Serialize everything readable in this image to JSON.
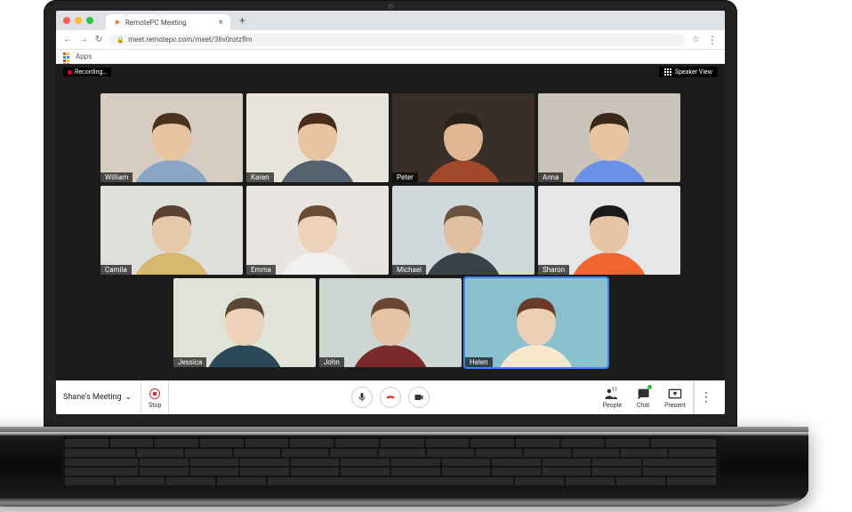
{
  "browser": {
    "tab_title": "RemotePC Meeting",
    "url": "meet.remotepc.com/meet/36v0rotzflm",
    "apps_label": "Apps"
  },
  "topbar": {
    "recording_label": "Recording…",
    "speaker_view_label": "Speaker View"
  },
  "participants": [
    {
      "name": "William",
      "bg": "#d6ccc2",
      "skin": "#e8c4a0",
      "hair": "#4a3420",
      "shirt": "#89a7c4"
    },
    {
      "name": "Karen",
      "bg": "#e8e4dc",
      "skin": "#e8c4a0",
      "hair": "#4a2c1a",
      "shirt": "#556270"
    },
    {
      "name": "Peter",
      "bg": "#3a2f28",
      "skin": "#dfb793",
      "hair": "#2a2018",
      "shirt": "#a0492a"
    },
    {
      "name": "Anna",
      "bg": "#c9c3ba",
      "skin": "#e8c4a0",
      "hair": "#3a2818",
      "shirt": "#6b90e8"
    },
    {
      "name": "Camila",
      "bg": "#dedfda",
      "skin": "#e5c8aa",
      "hair": "#5a4030",
      "shirt": "#d6b870"
    },
    {
      "name": "Emma",
      "bg": "#e8e5e0",
      "skin": "#ecd2b8",
      "hair": "#6a4c34",
      "shirt": "#f0f0f0"
    },
    {
      "name": "Michael",
      "bg": "#d0d8db",
      "skin": "#e0bfa0",
      "hair": "#6a5440",
      "shirt": "#3a4048"
    },
    {
      "name": "Sharon",
      "bg": "#e6e6e6",
      "skin": "#e5c5a5",
      "hair": "#1a1a1a",
      "shirt": "#f06530"
    },
    {
      "name": "Jessica",
      "bg": "#dfe3d8",
      "skin": "#ecd2b8",
      "hair": "#5a4835",
      "shirt": "#2a4a5a"
    },
    {
      "name": "John",
      "bg": "#cdd6d0",
      "skin": "#e5c5a5",
      "hair": "#6a4530",
      "shirt": "#7a2a2a"
    },
    {
      "name": "Helen",
      "bg": "#8abfcc",
      "skin": "#ecd0b5",
      "hair": "#6a3a28",
      "shirt": "#f8e8d0",
      "active": true
    }
  ],
  "toolbar": {
    "meeting_name": "Shane's Meeting",
    "stop_label": "Stop",
    "people_label": "People",
    "people_count": "11",
    "chat_label": "Chat",
    "present_label": "Present"
  }
}
